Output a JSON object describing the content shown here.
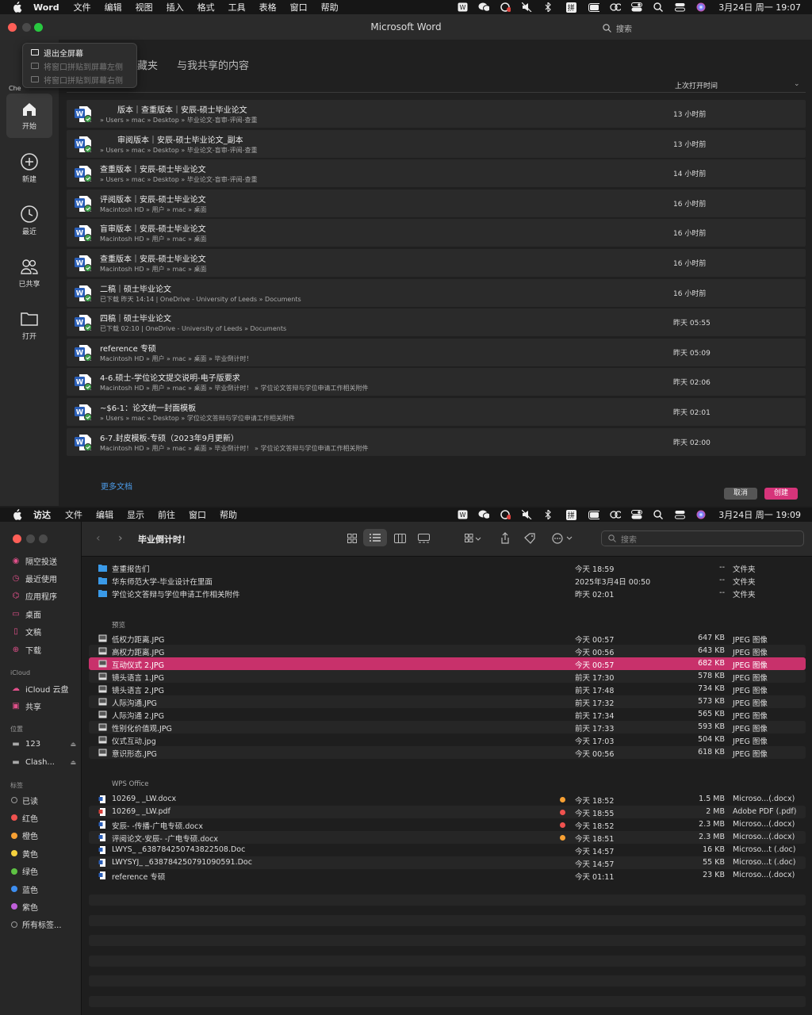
{
  "menubar_top": {
    "app": "Word",
    "items": [
      "文件",
      "编辑",
      "视图",
      "插入",
      "格式",
      "工具",
      "表格",
      "窗口",
      "帮助"
    ],
    "ime": "拼",
    "datetime": "3月24日 周一 19:07"
  },
  "word": {
    "title": "Microsoft Word",
    "search_placeholder": "搜索",
    "sidebar_hint": "Che",
    "tabs": [
      "藏夹",
      "与我共享的内容"
    ],
    "sort_label": "上次打开时间",
    "context_menu": [
      "退出全屏幕",
      "将窗口拼贴到屏幕左侧",
      "将窗口拼贴到屏幕右侧"
    ],
    "sidebar": [
      {
        "label": "开始",
        "icon": "home-icon"
      },
      {
        "label": "新建",
        "icon": "plus-circle-icon"
      },
      {
        "label": "最近",
        "icon": "clock-icon"
      },
      {
        "label": "已共享",
        "icon": "people-icon"
      },
      {
        "label": "打开",
        "icon": "folder-icon"
      }
    ],
    "docs": [
      {
        "name": "版本｜查重版本｜安辰-硕士毕业论文",
        "path": "» Users » mac » Desktop » 毕业论文-盲审-评阅-查重",
        "time": "13 小时前"
      },
      {
        "name": "审阅版本｜安辰-硕士毕业论文_副本",
        "path": "» Users » mac » Desktop » 毕业论文-盲审-评阅-查重",
        "time": "13 小时前"
      },
      {
        "name": "查重版本｜安辰-硕士毕业论文",
        "path": "» Users » mac » Desktop » 毕业论文-盲审-评阅-查重",
        "time": "14 小时前"
      },
      {
        "name": "评阅版本｜安辰-硕士毕业论文",
        "path": "Macintosh HD » 用户 » mac » 桌面",
        "time": "16 小时前"
      },
      {
        "name": "盲审版本｜安辰-硕士毕业论文",
        "path": "Macintosh HD » 用户 » mac » 桌面",
        "time": "16 小时前"
      },
      {
        "name": "查重版本｜安辰-硕士毕业论文",
        "path": "Macintosh HD » 用户 » mac » 桌面",
        "time": "16 小时前"
      },
      {
        "name": "二稿｜硕士毕业论文",
        "path": "已下载 昨天 14:14 | OneDrive - University of Leeds » Documents",
        "time": "16 小时前"
      },
      {
        "name": "四稿｜硕士毕业论文",
        "path": "已下载 02:10 | OneDrive - University of Leeds » Documents",
        "time": "昨天 05:55"
      },
      {
        "name": "reference 专硕",
        "path": "Macintosh HD » 用户 » mac » 桌面 » 毕业倒计时！",
        "time": "昨天 05:09"
      },
      {
        "name": "4-6.硕士-学位论文提交说明-电子版要求",
        "path": "Macintosh HD » 用户 » mac » 桌面 » 毕业倒计时！ » 学位论文答辩与学位申请工作相关附件",
        "time": "昨天 02:06"
      },
      {
        "name": "~$6-1：论文统一封面模板",
        "path": "» Users » mac » Desktop » 学位论文答辩与学位申请工作相关附件",
        "time": "昨天 02:01"
      },
      {
        "name": "6-7.封皮模板-专硕（2023年9月更新）",
        "path": "Macintosh HD » 用户 » mac » 桌面 » 毕业倒计时！ » 学位论文答辩与学位申请工作相关附件",
        "time": "昨天 02:00"
      }
    ],
    "more_docs": "更多文档",
    "cancel_label": "取消",
    "create_label": "创建"
  },
  "menubar_bottom": {
    "app": "访达",
    "items": [
      "文件",
      "编辑",
      "显示",
      "前往",
      "窗口",
      "帮助"
    ],
    "ime": "拼",
    "datetime": "3月24日 周一 19:09"
  },
  "finder": {
    "title": "毕业倒计时！",
    "search_placeholder": "搜索",
    "sidebar": {
      "favorites": [
        "隔空投送",
        "最近使用",
        "应用程序",
        "桌面",
        "文稿",
        "下载"
      ],
      "icloud_head": "iCloud",
      "icloud": [
        "iCloud 云盘",
        "共享"
      ],
      "locations_head": "位置",
      "locations": [
        "123",
        "Clash..."
      ],
      "tags_head": "标签",
      "tags": [
        {
          "label": "已读",
          "color": "#000000"
        },
        {
          "label": "红色",
          "color": "#f0524f"
        },
        {
          "label": "橙色",
          "color": "#f7a033"
        },
        {
          "label": "黄色",
          "color": "#f5d13d"
        },
        {
          "label": "绿色",
          "color": "#5ec243"
        },
        {
          "label": "蓝色",
          "color": "#3d8ef0"
        },
        {
          "label": "紫色",
          "color": "#bf5fd9"
        },
        {
          "label": "所有标签...",
          "color": ""
        }
      ]
    },
    "folders": [
      {
        "name": "查重报告们",
        "date": "今天 18:59",
        "size": "--",
        "kind": "文件夹"
      },
      {
        "name": "华东师范大学-毕业设计在里面",
        "date": "2025年3月4日 00:50",
        "size": "--",
        "kind": "文件夹"
      },
      {
        "name": "学位论文答辩与学位申请工作相关附件",
        "date": "昨天 02:01",
        "size": "--",
        "kind": "文件夹"
      }
    ],
    "group_preview": "预览",
    "images": [
      {
        "name": "低权力距离.JPG",
        "date": "今天 00:57",
        "size": "647 KB",
        "kind": "JPEG 图像"
      },
      {
        "name": "高权力距离.JPG",
        "date": "今天 00:56",
        "size": "643 KB",
        "kind": "JPEG 图像"
      },
      {
        "name": "互动仪式 2.JPG",
        "date": "今天 00:57",
        "size": "682 KB",
        "kind": "JPEG 图像",
        "selected": true
      },
      {
        "name": "镜头语言 1.JPG",
        "date": "前天 17:30",
        "size": "578 KB",
        "kind": "JPEG 图像"
      },
      {
        "name": "镜头语言 2.JPG",
        "date": "前天 17:48",
        "size": "734 KB",
        "kind": "JPEG 图像"
      },
      {
        "name": "人际沟通.JPG",
        "date": "前天 17:32",
        "size": "573 KB",
        "kind": "JPEG 图像"
      },
      {
        "name": "人际沟通 2.JPG",
        "date": "前天 17:34",
        "size": "565 KB",
        "kind": "JPEG 图像"
      },
      {
        "name": "性别化价值观.JPG",
        "date": "前天 17:33",
        "size": "593 KB",
        "kind": "JPEG 图像"
      },
      {
        "name": "仪式互动.jpg",
        "date": "今天 17:03",
        "size": "504 KB",
        "kind": "JPEG 图像"
      },
      {
        "name": "意识形态.JPG",
        "date": "今天 00:56",
        "size": "618 KB",
        "kind": "JPEG 图像"
      }
    ],
    "group_wps": "WPS Office",
    "wps": [
      {
        "name": "10269_                  _LW.docx",
        "date": "今天 18:52",
        "size": "1.5 MB",
        "kind": "Microso...(.docx)",
        "tag": "#f7a033",
        "icon": "doc"
      },
      {
        "name": "10269_                  _LW.pdf",
        "date": "今天 18:55",
        "size": "2 MB",
        "kind": "Adobe PDF (.pdf)",
        "tag": "#f0524f",
        "icon": "pdf"
      },
      {
        "name": "安辰-                   -传播-广电专硕.docx",
        "date": "今天 18:52",
        "size": "2.3 MB",
        "kind": "Microso...(.docx)",
        "tag": "#f0524f",
        "icon": "doc"
      },
      {
        "name": "评阅论文-安辰-                    -广电专硕.docx",
        "date": "今天 18:51",
        "size": "2.3 MB",
        "kind": "Microso...(.docx)",
        "tag": "#f7a033",
        "icon": "doc"
      },
      {
        "name": "LWYS_                  _638784250743822508.Doc",
        "date": "今天 14:57",
        "size": "16 KB",
        "kind": "Microso...t (.doc)",
        "tag": "",
        "icon": "doc"
      },
      {
        "name": "LWYSYJ_                _638784250791090591.Doc",
        "date": "今天 14:57",
        "size": "55 KB",
        "kind": "Microso...t (.doc)",
        "tag": "",
        "icon": "doc"
      },
      {
        "name": "reference 专硕",
        "date": "今天 01:11",
        "size": "23 KB",
        "kind": "Microso...(.docx)",
        "tag": "",
        "icon": "doc"
      }
    ]
  },
  "colors": {
    "accent_pink": "#c8316b",
    "create_button": "#d6347a",
    "link_blue": "#4c9be8",
    "folder_blue": "#3a9ae8",
    "word_blue": "#2b5fb8"
  }
}
